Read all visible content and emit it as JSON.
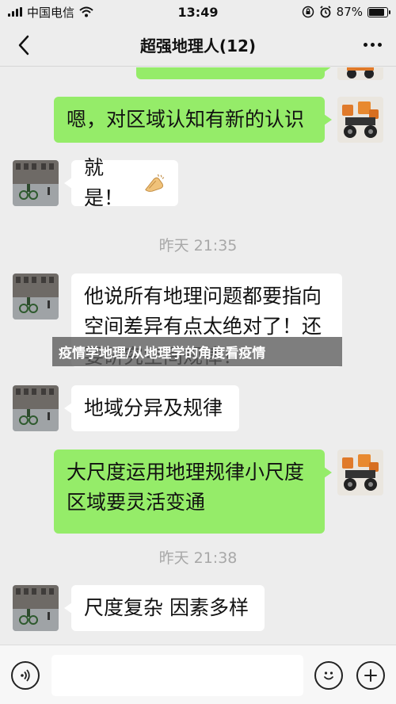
{
  "status_bar": {
    "carrier": "中国电信",
    "time": "13:49",
    "battery_percent": "87%",
    "battery_level": 0.87
  },
  "nav": {
    "title": "超强地理人(12)"
  },
  "messages": [
    {
      "side": "mine",
      "text": "嗯，对区域认知有新的认识"
    },
    {
      "side": "other",
      "text": "就是！"
    },
    {
      "side": "time",
      "text": "昨天 21:35"
    },
    {
      "side": "other",
      "text": "他说所有地理问题都要指向空间差异有点太绝对了！还要研究空间规律！"
    },
    {
      "side": "other",
      "text": "地域分异及规律"
    },
    {
      "side": "mine",
      "text": "大尺度运用地理规律小尺度区域要灵活变通"
    },
    {
      "side": "time",
      "text": "昨天 21:38"
    },
    {
      "side": "other",
      "text": "尺度复杂 因素多样"
    }
  ],
  "overlay": {
    "caption": "疫情学地理/从地理学的角度看疫情"
  },
  "icons": {
    "back": "chevron-left-icon",
    "more": "more-dots-icon",
    "voice": "voice-icon",
    "emoji": "emoji-icon",
    "plus": "plus-icon",
    "clap": "applause-emoji-icon"
  },
  "colors": {
    "my_bubble": "#95ec69",
    "other_bubble": "#ffffff",
    "background": "#ededed"
  }
}
